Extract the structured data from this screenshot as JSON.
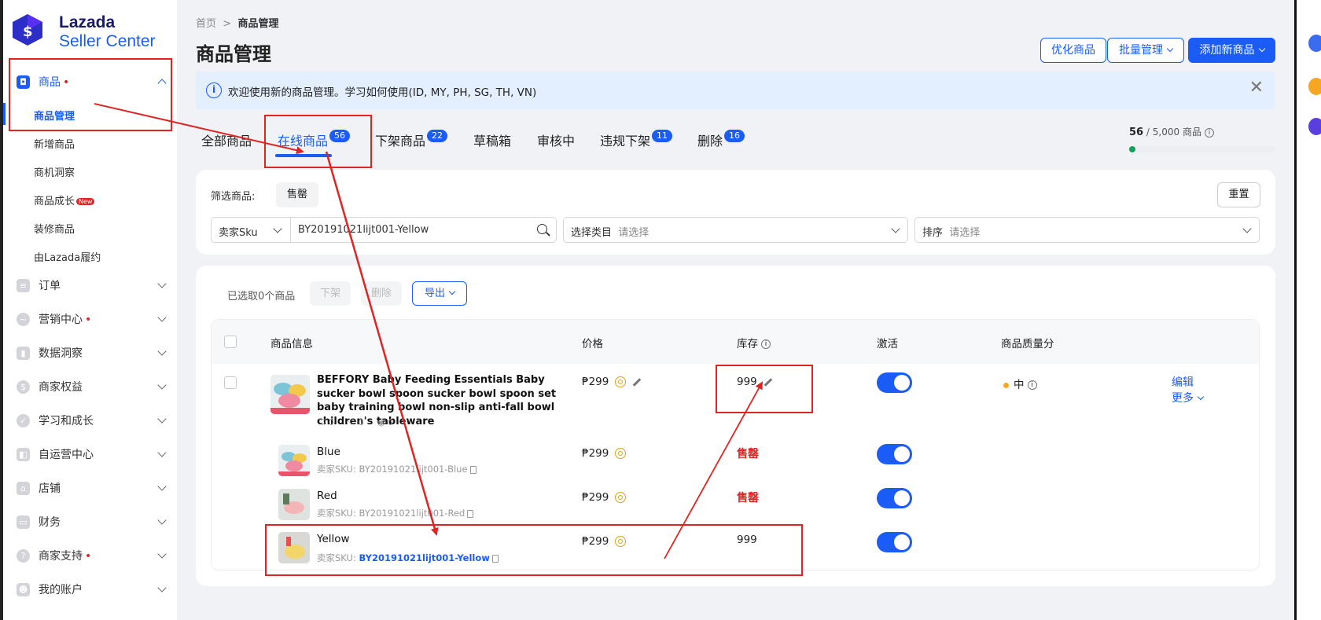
{
  "brand": {
    "line1": "Lazada",
    "line2": "Seller Center"
  },
  "sidebar": {
    "product": {
      "label": "商品",
      "dot": "•"
    },
    "sub_items": [
      {
        "label": "商品管理"
      },
      {
        "label": "新增商品"
      },
      {
        "label": "商机洞察"
      },
      {
        "label": "商品成长",
        "badge": "New"
      },
      {
        "label": "装修商品"
      },
      {
        "label": "由Lazada履约"
      }
    ],
    "sections": [
      {
        "label": "订单",
        "dot": ""
      },
      {
        "label": "营销中心",
        "dot": "•"
      },
      {
        "label": "数据洞察",
        "dot": ""
      },
      {
        "label": "商家权益",
        "dot": ""
      },
      {
        "label": "学习和成长",
        "dot": ""
      },
      {
        "label": "自运营中心",
        "dot": ""
      },
      {
        "label": "店铺",
        "dot": ""
      },
      {
        "label": "财务",
        "dot": ""
      },
      {
        "label": "商家支持",
        "dot": "•"
      },
      {
        "label": "我的账户",
        "dot": ""
      }
    ]
  },
  "breadcrumb": {
    "home": "首页",
    "sep": ">",
    "current": "商品管理"
  },
  "page_title": "商品管理",
  "header_buttons": {
    "optimize": "优化商品",
    "bulk": "批量管理",
    "add": "添加新商品"
  },
  "banner": {
    "text": "欢迎使用新的商品管理。学习如何使用(ID, MY, PH, SG, TH, VN)",
    "close": "✕"
  },
  "tabs": [
    {
      "label": "全部商品",
      "badge": ""
    },
    {
      "label": "在线商品",
      "badge": "56"
    },
    {
      "label": "下架商品",
      "badge": "22"
    },
    {
      "label": "草稿箱",
      "badge": ""
    },
    {
      "label": "审核中",
      "badge": ""
    },
    {
      "label": "违规下架",
      "badge": "11"
    },
    {
      "label": "删除",
      "badge": "16"
    }
  ],
  "quota": {
    "count": "56",
    "rest": "/ 5,000 商品",
    "fill_fraction": 0.0112
  },
  "filter": {
    "label": "筛选商品:",
    "chip": "售罄",
    "reset": "重置",
    "sku_select": "卖家Sku",
    "sku_value": "BY20191021lijt001-Yellow",
    "category_label": "选择类目",
    "category_placeholder": "请选择",
    "sort_label": "排序",
    "sort_placeholder": "请选择"
  },
  "actions": {
    "selected": "已选取0个商品",
    "delist": "下架",
    "delete": "删除",
    "export": "导出"
  },
  "columns": {
    "info": "商品信息",
    "price": "价格",
    "stock": "库存",
    "active": "激活",
    "quality": "商品质量分"
  },
  "product": {
    "name": "BEFFORY Baby Feeding Essentials Baby sucker bowl spoon sucker bowl spoon set baby training bowl non-slip anti-fall bowl children's tableware",
    "stat1": "0",
    "stat2": "0",
    "stat3": "0",
    "price": "₱299",
    "stock": "999",
    "quality": "中",
    "edit": "编辑",
    "more": "更多"
  },
  "variants": [
    {
      "name": "Blue",
      "sku_prefix": "卖家SKU: ",
      "sku": "BY20191021lijt001-Blue",
      "price": "₱299",
      "stock": "售罄",
      "stock_soldout": true
    },
    {
      "name": "Red",
      "sku_prefix": "卖家SKU: ",
      "sku": "BY20191021lijt001-Red",
      "price": "₱299",
      "stock": "售罄",
      "stock_soldout": true
    },
    {
      "name": "Yellow",
      "sku_prefix": "卖家SKU: ",
      "sku": "BY20191021lijt001-Yellow",
      "price": "₱299",
      "stock": "999",
      "stock_soldout": false
    }
  ],
  "colors": {
    "accent": "#1a5cf5",
    "annotation": "#e02424",
    "soldout": "#e02424",
    "quality_dot": "#f5a623"
  }
}
